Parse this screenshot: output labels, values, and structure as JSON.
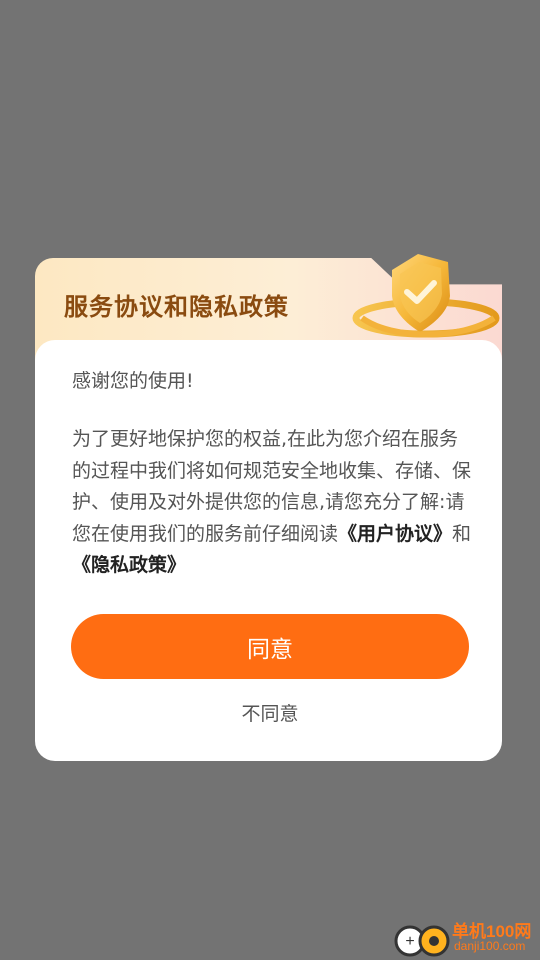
{
  "dialog": {
    "title": "服务协议和隐私政策",
    "greeting": "感谢您的使用!",
    "body_part1": "为了更好地保护您的权益,在此为您介绍在服务的过程中我们将如何规范安全地收集、存储、保护、使用及对外提供您的信息,请您充分了解:请您在使用我们的服务前仔细阅读",
    "user_agreement_link": "《用户协议》",
    "conjunction": "和",
    "privacy_policy_link": "《隐私政策》",
    "agree_label": "同意",
    "disagree_label": "不同意"
  },
  "watermark": {
    "name": "单机100网",
    "site": "danji100.com",
    "logo_lettering": "+"
  },
  "colors": {
    "overlay": "#737373",
    "accent": "#ff6d12",
    "title": "#8a4b10"
  },
  "icons": {
    "badge": "gold-shield-check-icon",
    "watermark_logo": "gamepad-logo-icon"
  }
}
